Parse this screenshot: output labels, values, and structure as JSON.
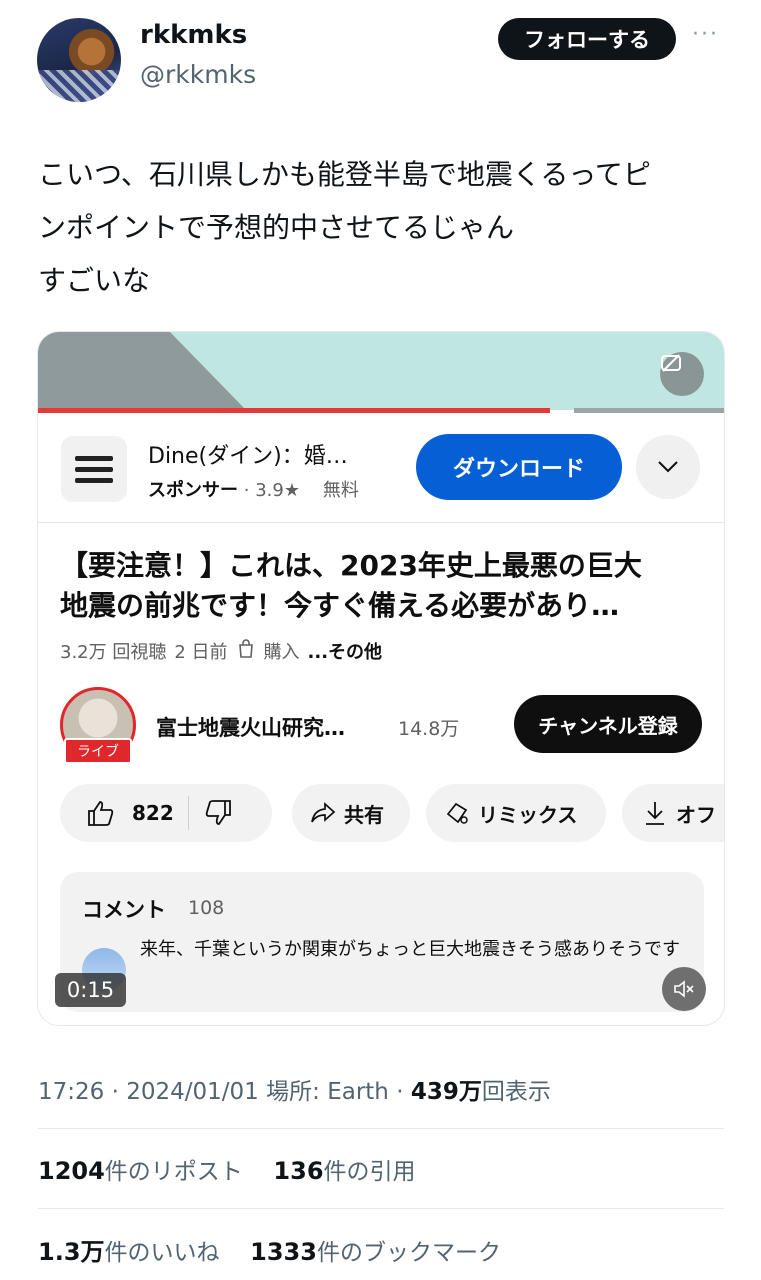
{
  "author": {
    "name": "rkkmks",
    "handle": "@rkkmks"
  },
  "follow_label": "フォローする",
  "more_label": "···",
  "tweet_lines": [
    "こいつ、石川県しかも能登半島で地震くるってピ",
    "ンポイントで予想的中させてるじゃん",
    "すごいな"
  ],
  "video": {
    "ad": {
      "app_name": "Dine(ダイン)：婚…",
      "sponsor_label": "スポンサー",
      "rating": "3.9★",
      "price": "無料",
      "download_label": "ダウンロード"
    },
    "title_lines": [
      "【要注意！】これは、2023年史上最悪の巨大",
      "地震の前兆です！今すぐ備える必要があり…"
    ],
    "views": "3.2万 回視聴",
    "age": "2 日前",
    "purchase_label": "購入",
    "more_label": "...その他",
    "channel": {
      "name": "富士地震火山研究…",
      "subscribers": "14.8万",
      "live_label": "ライブ",
      "subscribe_label": "チャンネル登録"
    },
    "actions": {
      "likes": "822",
      "share_label": "共有",
      "remix_label": "リミックス",
      "offline_label": "オフ"
    },
    "comments": {
      "title": "コメント",
      "count": "108",
      "top_comment": "来年、千葉というか関東がちょっと巨大地震きそう感ありそうです"
    },
    "timestamp": "0:15"
  },
  "meta": {
    "time": "17:26",
    "date": "2024/01/01",
    "location_label": "場所:",
    "location": "Earth",
    "views_count": "439万",
    "views_label": "回表示"
  },
  "stats": {
    "reposts_count": "1204",
    "reposts_label": "件のリポスト",
    "quotes_count": "136",
    "quotes_label": "件の引用",
    "likes_count": "1.3万",
    "likes_label": "件のいいね",
    "bookmarks_count": "1333",
    "bookmarks_label": "件のブックマーク"
  }
}
